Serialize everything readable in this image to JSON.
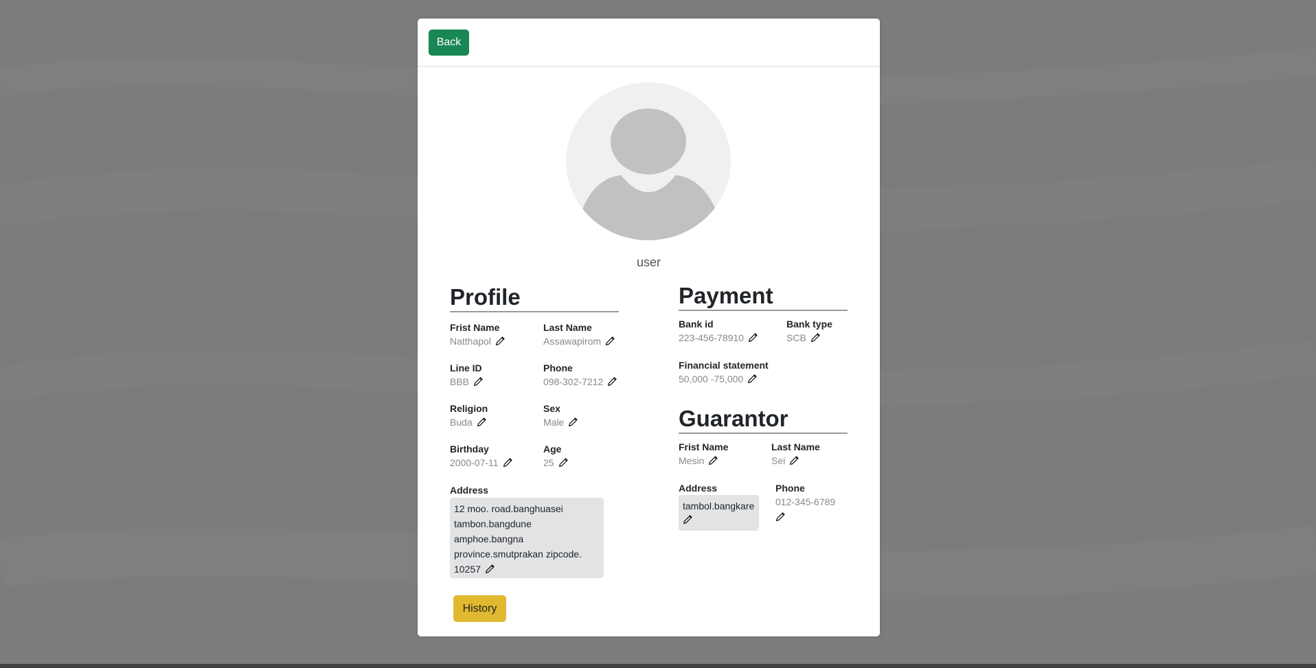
{
  "header": {
    "back_label": "Back"
  },
  "user": {
    "name": "user"
  },
  "profile": {
    "title": "Profile",
    "first_name": {
      "label": "Frist Name",
      "value": "Natthapol"
    },
    "last_name": {
      "label": "Last Name",
      "value": "Assawapirom"
    },
    "line_id": {
      "label": "Line ID",
      "value": "BBB"
    },
    "phone": {
      "label": "Phone",
      "value": "098-302-7212"
    },
    "religion": {
      "label": "Religion",
      "value": "Buda"
    },
    "sex": {
      "label": "Sex",
      "value": "Male"
    },
    "birthday": {
      "label": "Birthday",
      "value": "2000-07-11"
    },
    "age": {
      "label": "Age",
      "value": "25"
    },
    "address": {
      "label": "Address",
      "lines": [
        "12 moo. road.banghuasei",
        "tambon.bangdune",
        "amphoe.bangna",
        "province.smutprakan zipcode.",
        "10257"
      ]
    }
  },
  "payment": {
    "title": "Payment",
    "bank_id": {
      "label": "Bank id",
      "value": "223-456-78910"
    },
    "bank_type": {
      "label": "Bank type",
      "value": "SCB"
    },
    "financial_statement": {
      "label": "Financial statement",
      "value": "50,000 -75,000"
    }
  },
  "guarantor": {
    "title": "Guarantor",
    "first_name": {
      "label": "Frist Name",
      "value": "Mesin"
    },
    "last_name": {
      "label": "Last Name",
      "value": "Sei"
    },
    "address": {
      "label": "Address",
      "value": "tambol.bangkare"
    },
    "phone": {
      "label": "Phone",
      "value": "012-345-6789"
    }
  },
  "actions": {
    "history_label": "History"
  },
  "icons": {
    "edit": "pencil-icon",
    "avatar": "user-avatar-icon"
  },
  "colors": {
    "back_button": "#198754",
    "history_button": "#e0b930",
    "background": "#7b7c7d"
  }
}
